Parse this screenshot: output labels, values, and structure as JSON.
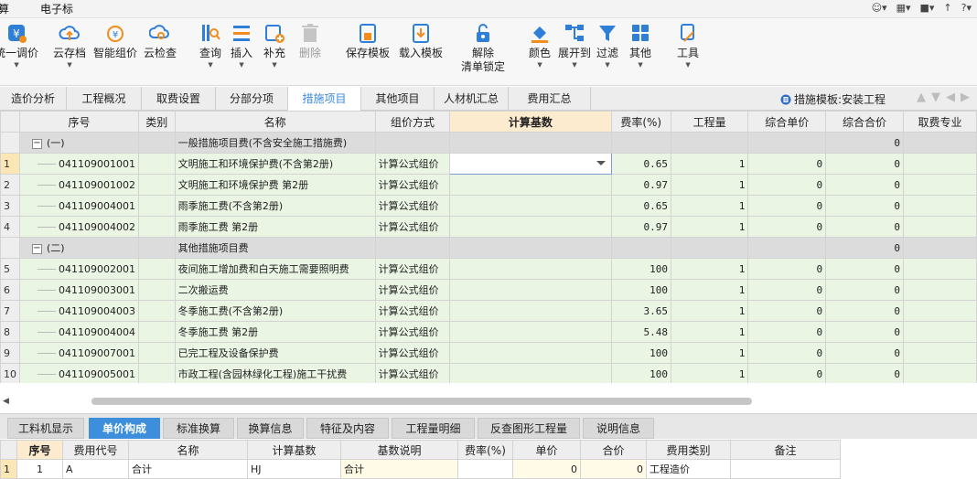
{
  "menu": {
    "items": [
      "算",
      "电子标"
    ]
  },
  "ribbon": {
    "buttons": [
      {
        "label": "统一调价",
        "icon": "adjust-price-icon",
        "dropdown": true
      },
      {
        "label": "云存档",
        "icon": "cloud-upload-icon",
        "dropdown": true
      },
      {
        "label": "智能组价",
        "icon": "smart-pricing-icon",
        "dropdown": false
      },
      {
        "label": "云检查",
        "icon": "cloud-check-icon",
        "dropdown": false
      },
      {
        "label": "查询",
        "icon": "query-icon",
        "dropdown": true
      },
      {
        "label": "插入",
        "icon": "insert-icon",
        "dropdown": true
      },
      {
        "label": "补充",
        "icon": "supplement-icon",
        "dropdown": true
      },
      {
        "label": "删除",
        "icon": "trash-icon",
        "dropdown": false,
        "disabled": true
      },
      {
        "label": "保存模板",
        "icon": "save-template-icon",
        "dropdown": false
      },
      {
        "label": "载入模板",
        "icon": "load-template-icon",
        "dropdown": false
      },
      {
        "label": "解除",
        "label2": "清单锁定",
        "icon": "unlock-icon",
        "dropdown": false
      },
      {
        "label": "颜色",
        "icon": "paint-bucket-icon",
        "dropdown": true
      },
      {
        "label": "展开到",
        "icon": "expand-tree-icon",
        "dropdown": true
      },
      {
        "label": "过滤",
        "icon": "filter-icon",
        "dropdown": true
      },
      {
        "label": "其他",
        "icon": "grid-apps-icon",
        "dropdown": true
      },
      {
        "label": "工具",
        "icon": "tools-icon",
        "dropdown": true
      }
    ]
  },
  "tabs": [
    "造价分析",
    "工程概况",
    "取费设置",
    "分部分项",
    "措施项目",
    "其他项目",
    "人材机汇总",
    "费用汇总"
  ],
  "active_tab": "措施项目",
  "template_label": "措施模板:安装工程",
  "grid": {
    "columns": [
      "序号",
      "类别",
      "名称",
      "组价方式",
      "计算基数",
      "费率(%)",
      "工程量",
      "综合单价",
      "综合合价",
      "取费专业"
    ],
    "rows": [
      {
        "rn": "",
        "type": "group",
        "seq": "(一)",
        "name": "一般措施项目费(不含安全施工措施费)",
        "method": "",
        "base": "",
        "rate": "",
        "qty": "",
        "unit_price": "",
        "total": "0"
      },
      {
        "rn": "1",
        "type": "item",
        "seq": "041109001001",
        "name": "文明施工和环境保护费(不含第2册)",
        "method": "计算公式组价",
        "base": "",
        "rate": "0.65",
        "qty": "1",
        "unit_price": "0",
        "total": "0",
        "selected": true
      },
      {
        "rn": "2",
        "type": "item",
        "seq": "041109001002",
        "name": "文明施工和环境保护费 第2册",
        "method": "计算公式组价",
        "base": "",
        "rate": "0.97",
        "qty": "1",
        "unit_price": "0",
        "total": "0"
      },
      {
        "rn": "3",
        "type": "item",
        "seq": "041109004001",
        "name": "雨季施工费(不含第2册)",
        "method": "计算公式组价",
        "base": "",
        "rate": "0.65",
        "qty": "1",
        "unit_price": "0",
        "total": "0"
      },
      {
        "rn": "4",
        "type": "item",
        "seq": "041109004002",
        "name": "雨季施工费 第2册",
        "method": "计算公式组价",
        "base": "",
        "rate": "0.97",
        "qty": "1",
        "unit_price": "0",
        "total": "0"
      },
      {
        "rn": "",
        "type": "group",
        "seq": "(二)",
        "name": "其他措施项目费",
        "method": "",
        "base": "",
        "rate": "",
        "qty": "",
        "unit_price": "",
        "total": "0"
      },
      {
        "rn": "5",
        "type": "item",
        "seq": "041109002001",
        "name": "夜间施工增加费和白天施工需要照明费",
        "method": "计算公式组价",
        "base": "",
        "rate": "100",
        "qty": "1",
        "unit_price": "0",
        "total": "0"
      },
      {
        "rn": "6",
        "type": "item",
        "seq": "041109003001",
        "name": "二次搬运费",
        "method": "计算公式组价",
        "base": "",
        "rate": "100",
        "qty": "1",
        "unit_price": "0",
        "total": "0"
      },
      {
        "rn": "7",
        "type": "item",
        "seq": "041109004003",
        "name": "冬季施工费(不含第2册)",
        "method": "计算公式组价",
        "base": "",
        "rate": "3.65",
        "qty": "1",
        "unit_price": "0",
        "total": "0"
      },
      {
        "rn": "8",
        "type": "item",
        "seq": "041109004004",
        "name": "冬季施工费 第2册",
        "method": "计算公式组价",
        "base": "",
        "rate": "5.48",
        "qty": "1",
        "unit_price": "0",
        "total": "0"
      },
      {
        "rn": "9",
        "type": "item",
        "seq": "041109007001",
        "name": "已完工程及设备保护费",
        "method": "计算公式组价",
        "base": "",
        "rate": "100",
        "qty": "1",
        "unit_price": "0",
        "total": "0"
      },
      {
        "rn": "10",
        "type": "item",
        "seq": "041109005001",
        "name": "市政工程(含园林绿化工程)施工干扰费",
        "method": "计算公式组价",
        "base": "",
        "rate": "100",
        "qty": "1",
        "unit_price": "0",
        "total": "0"
      }
    ]
  },
  "bottom_tabs": [
    "工料机显示",
    "单价构成",
    "标准换算",
    "换算信息",
    "特征及内容",
    "工程量明细",
    "反查图形工程量",
    "说明信息"
  ],
  "bottom_active_tab": "单价构成",
  "bottom_grid": {
    "columns": [
      "序号",
      "费用代号",
      "名称",
      "计算基数",
      "基数说明",
      "费率(%)",
      "单价",
      "合价",
      "费用类别",
      "备注"
    ],
    "rows": [
      {
        "rn": "1",
        "seq": "1",
        "code": "A",
        "name": "合计",
        "base": "HJ",
        "base_desc": "合计",
        "rate": "",
        "price": "0",
        "total": "0",
        "category": "工程造价",
        "note": ""
      }
    ]
  },
  "colors": {
    "accent": "#3d8fdc",
    "group_row": "#dcdcdc",
    "item_row": "#eaf5e4",
    "highlight_header": "#fdebcf"
  }
}
